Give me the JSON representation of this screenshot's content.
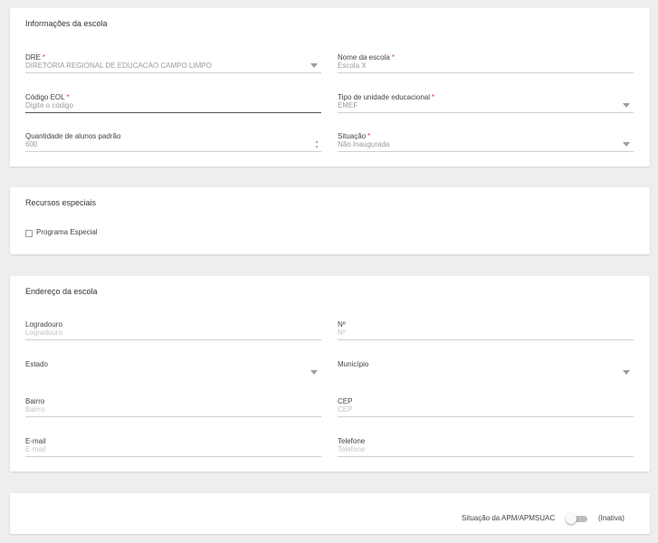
{
  "school_info": {
    "title": "Informações da escola",
    "dre": {
      "label": "DRE",
      "value": "DIRETORIA REGIONAL DE EDUCACAO CAMPO LIMPO"
    },
    "nome": {
      "label": "Nome da escola",
      "value": "Escola X"
    },
    "codigo_eol": {
      "label": "Código EOL",
      "placeholder": "Digite o código"
    },
    "tipo_unidade": {
      "label": "Tipo de unidade educacional",
      "value": "EMEF"
    },
    "qtd_alunos": {
      "label": "Quantidade de alunos padrão",
      "value": "600"
    },
    "situacao": {
      "label": "Situação",
      "value": "Não Inaugurada"
    }
  },
  "special_resources": {
    "title": "Recursos especiais",
    "programa_especial": {
      "label": "Programa Especial",
      "checked": false
    }
  },
  "address": {
    "title": "Endereço da escola",
    "logradouro": {
      "label": "Logradouro",
      "placeholder": "Logradouro"
    },
    "numero": {
      "label": "Nº",
      "placeholder": "Nº"
    },
    "estado": {
      "label": "Estado",
      "value": ""
    },
    "municipio": {
      "label": "Município",
      "value": ""
    },
    "bairro": {
      "label": "Bairro",
      "placeholder": "Bairro"
    },
    "cep": {
      "label": "CEP",
      "placeholder": "CEP"
    },
    "email": {
      "label": "E-mail",
      "placeholder": "E-mail"
    },
    "telefone": {
      "label": "Telefone",
      "placeholder": "Telefone"
    }
  },
  "apm": {
    "label": "Situação da APM/APMSUAC",
    "status": "(Inativa)",
    "active": false
  },
  "required_mark": "*"
}
